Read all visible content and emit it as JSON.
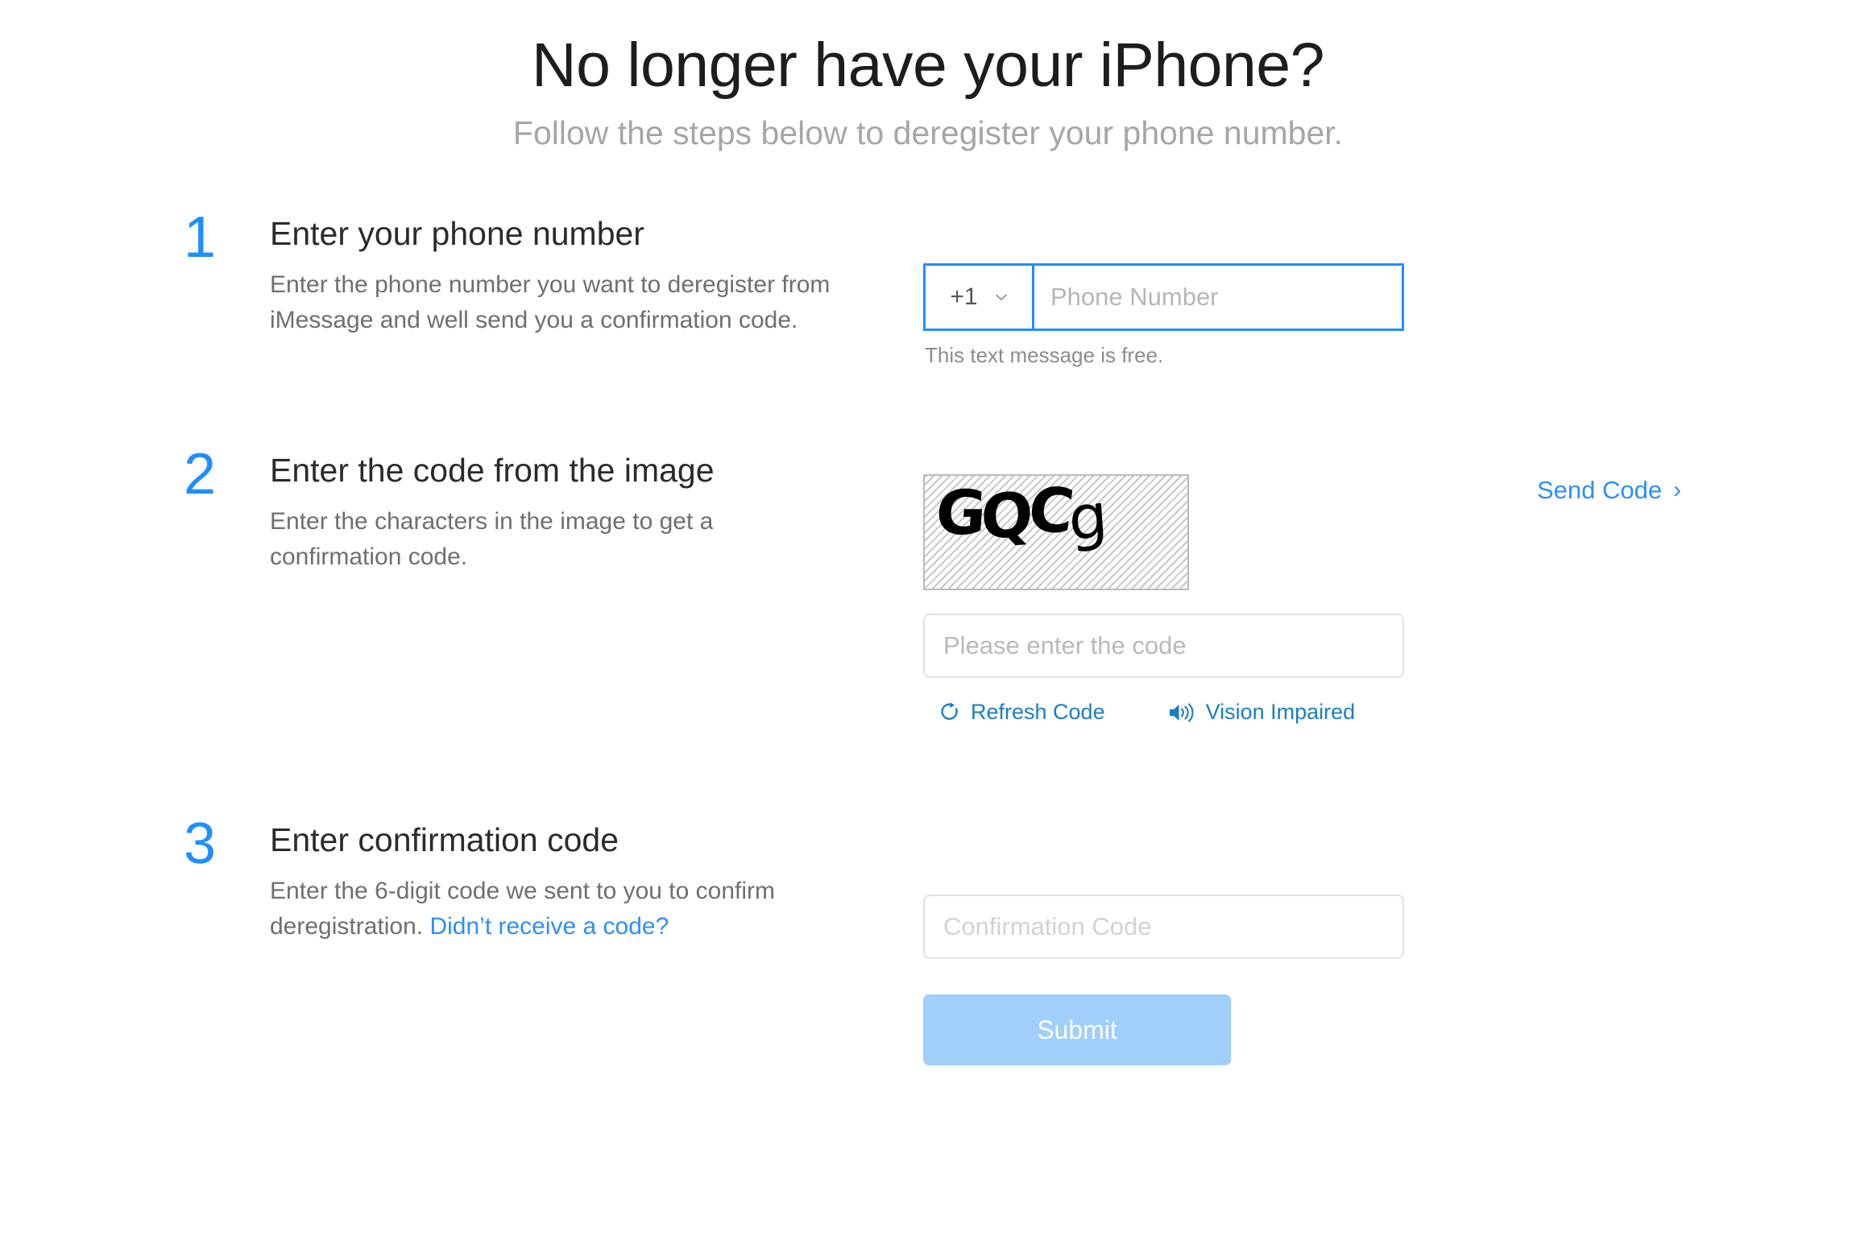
{
  "header": {
    "title": "No longer have your iPhone?",
    "subtitle": "Follow the steps below to deregister your phone number."
  },
  "steps": [
    {
      "number": "1",
      "heading": "Enter your phone number",
      "description": "Enter the phone number you want to deregister from iMessage and well send you a confirmation code.",
      "country_code": "+1",
      "phone_placeholder": "Phone Number",
      "hint": "This text message is free."
    },
    {
      "number": "2",
      "heading": "Enter the code from the image",
      "description": "Enter the characters in the image to get a confirmation code.",
      "captcha_text": "GQCg",
      "code_placeholder": "Please enter the code",
      "refresh_label": "Refresh Code",
      "vision_label": "Vision Impaired",
      "send_code_label": "Send Code",
      "send_code_caret": "›"
    },
    {
      "number": "3",
      "heading": "Enter confirmation code",
      "description_before_link": "Enter the 6-digit code we sent to you to confirm deregistration. ",
      "link_label": "Didn’t receive a code?",
      "confirmation_placeholder": "Confirmation Code",
      "submit_label": "Submit"
    }
  ],
  "icons": {
    "chevron_down": "chevron-down-icon",
    "refresh": "refresh-icon",
    "speaker": "speaker-icon"
  },
  "colors": {
    "accent_blue": "#1e8fff",
    "link_blue": "#2e8ff5",
    "action_blue": "#1b7ec4",
    "submit_blue": "#9fcffa",
    "title_gray": "#1d1d1f",
    "subtitle_gray": "#a6a6a6",
    "body_gray": "#6e6e73"
  }
}
